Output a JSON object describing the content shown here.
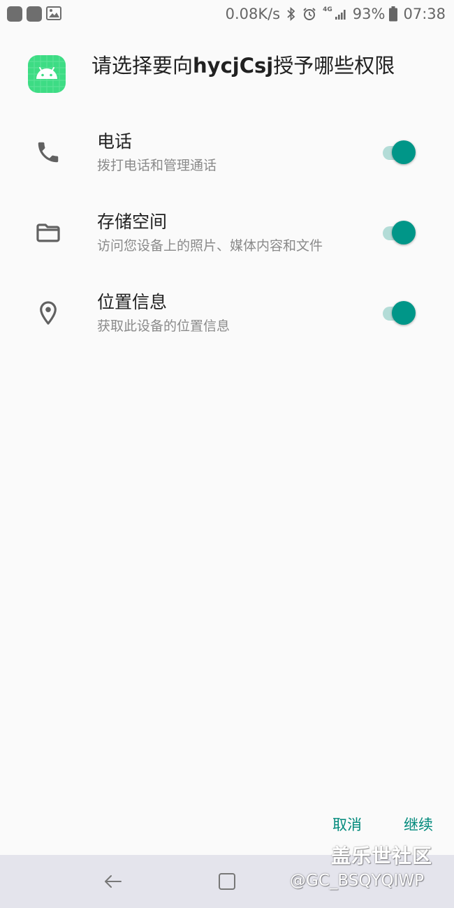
{
  "status_bar": {
    "net_speed": "0.08K/s",
    "network_type": "4G",
    "battery_percent": "93%",
    "time": "07:38",
    "icons": [
      "notification-icon",
      "notification-icon",
      "gallery-icon",
      "bluetooth-icon",
      "alarm-icon",
      "signal-icon",
      "battery-icon"
    ]
  },
  "dialog": {
    "title_prefix": "请选择要向",
    "app_name": "hycjCsj",
    "title_suffix": "授予哪些权限",
    "app_icon": "android-app-icon"
  },
  "permissions": [
    {
      "icon": "phone-icon",
      "title": "电话",
      "description": "拨打电话和管理通话",
      "enabled": true
    },
    {
      "icon": "folder-icon",
      "title": "存储空间",
      "description": "访问您设备上的照片、媒体内容和文件",
      "enabled": true
    },
    {
      "icon": "location-icon",
      "title": "位置信息",
      "description": "获取此设备的位置信息",
      "enabled": true
    }
  ],
  "buttons": {
    "cancel": "取消",
    "continue": "继续"
  },
  "nav_bar": {
    "icons": [
      "back-icon",
      "recents-icon"
    ]
  },
  "watermark": {
    "site": "盖乐世社区",
    "user": "@GC_BSQYQIWP"
  },
  "colors": {
    "accent": "#009688",
    "track": "#b3dcd7",
    "app_icon_bg": "#3ddc84",
    "background": "#fafafa",
    "nav_bar": "#e4e4ec"
  }
}
